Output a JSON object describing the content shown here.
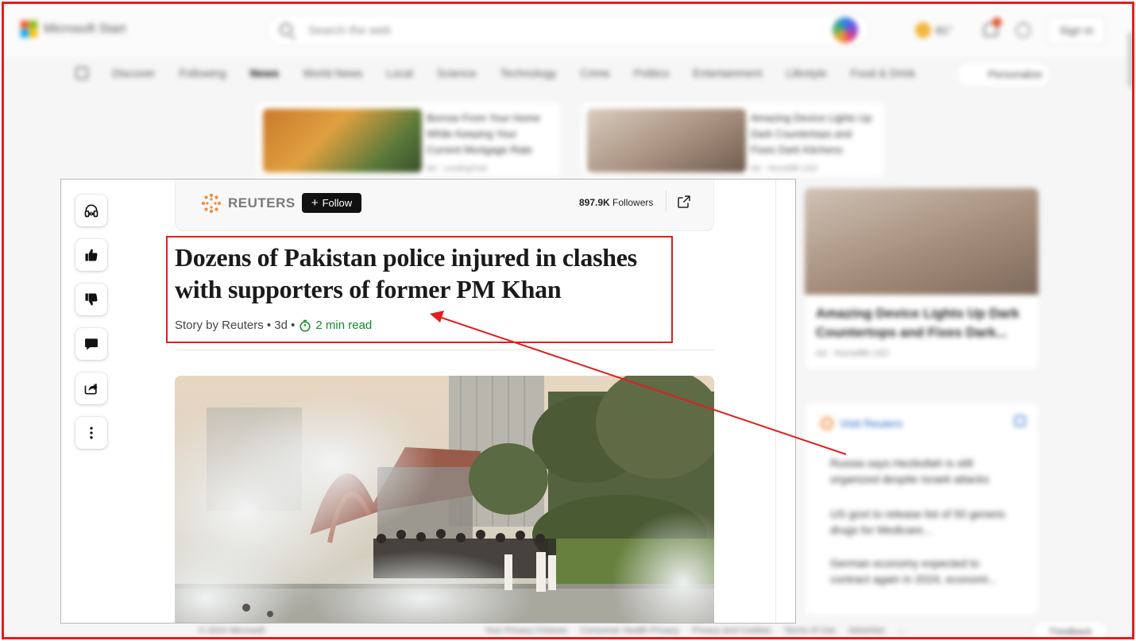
{
  "background": {
    "brand": "Microsoft Start",
    "search_placeholder": "Search the web",
    "weather": "81°",
    "signin": "Sign in",
    "nav": [
      "Discover",
      "Following",
      "News",
      "World News",
      "Local",
      "Science",
      "Technology",
      "Crime",
      "Politics",
      "Entertainment",
      "Lifestyle",
      "Food & Drink"
    ],
    "nav_active": "News",
    "personalize": "Personalize",
    "top_cards": [
      {
        "title": "Borrow From Your Home While Keeping Your Current Mortgage Rate",
        "meta": "Ad · LendingTree"
      },
      {
        "title": "Amazing Device Lights Up Dark Countertops and Fixes Dark Kitchens",
        "meta": "Ad · HomeBlk LED"
      }
    ],
    "right_feature": {
      "title": "Amazing Device Lights Up Dark Countertops and Fixes Dark...",
      "meta": "Ad · HomeBlk LED"
    },
    "right_panel": {
      "head": "Visit Reuters",
      "items": [
        "Russia says Hezbollah is still organized despite Israeli attacks",
        "US govt to release list of 50 generic drugs for Medicare...",
        "German economy expected to contract again in 2024, economi..."
      ]
    },
    "footer": "© 2024 Microsoft",
    "footer_links": [
      "Your Privacy Choices",
      "Consumer Health Privacy",
      "Privacy and Cookies",
      "Terms of Use",
      "Advertise",
      "..."
    ],
    "feedback": "Feedback"
  },
  "article": {
    "source_name": "REUTERS",
    "follow_label": "Follow",
    "followers_count": "897.9K",
    "followers_label": "Followers",
    "headline": "Dozens of Pakistan police injured in clashes with supporters of former PM Khan",
    "byline": "Story by Reuters • 3d •",
    "read_time": "2 min read"
  },
  "actions": [
    "headphones-icon",
    "thumbs-up-icon",
    "thumbs-down-icon",
    "comment-icon",
    "share-icon",
    "more-icon"
  ],
  "colors": {
    "annotation_red": "#e01f1f",
    "follow_button": "#111111",
    "read_time_green": "#138a2e",
    "reuters_orange": "#f08a3b"
  }
}
